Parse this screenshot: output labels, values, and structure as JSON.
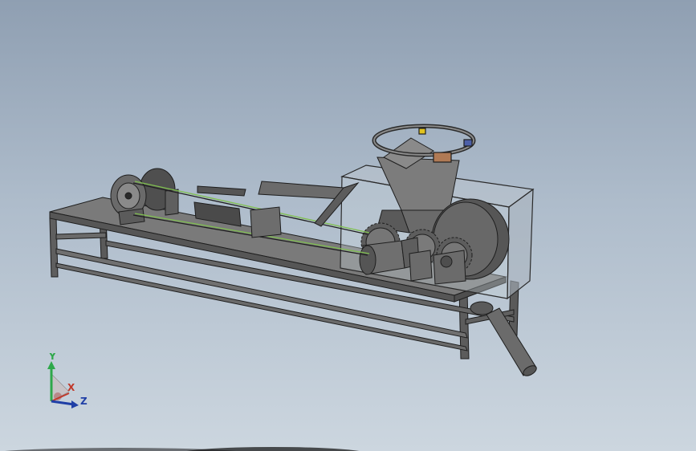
{
  "viewport": {
    "background_top": "#8f9fb2",
    "background_bottom": "#ccd6df",
    "model_fill": "#6f6f6f",
    "model_edge": "#1e1e1e",
    "glass_fill": "#c7d0d8",
    "belt_color": "#7fbf4f"
  },
  "triad": {
    "y_label": "Y",
    "x_label": "X",
    "z_label": "Z",
    "y_color": "#2ea84a",
    "x_color": "#c0392b",
    "z_color": "#1f3fa6"
  }
}
